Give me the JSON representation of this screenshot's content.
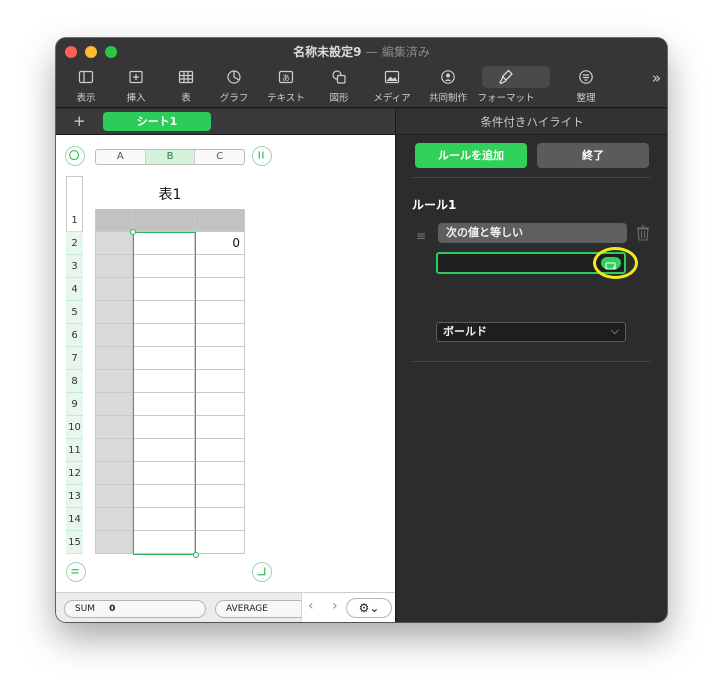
{
  "window": {
    "title": "名称未設定9",
    "separator": "—",
    "status": "編集済み"
  },
  "toolbar": {
    "items": [
      {
        "label": "表示",
        "icon": "view-icon"
      },
      {
        "label": "挿入",
        "icon": "insert-icon"
      },
      {
        "label": "表",
        "icon": "table-icon"
      },
      {
        "label": "グラフ",
        "icon": "chart-icon"
      },
      {
        "label": "テキスト",
        "icon": "text-icon"
      },
      {
        "label": "図形",
        "icon": "shape-icon"
      },
      {
        "label": "メディア",
        "icon": "media-icon"
      },
      {
        "label": "共同制作",
        "icon": "collaborate-icon"
      },
      {
        "label": "フォーマット",
        "icon": "format-icon"
      },
      {
        "label": "整理",
        "icon": "organize-icon"
      }
    ],
    "more": "»"
  },
  "sheet": {
    "add": "+",
    "tab": "シート1"
  },
  "table": {
    "columns": [
      "A",
      "B",
      "C"
    ],
    "title": "表1",
    "rows": [
      "1",
      "2",
      "3",
      "4",
      "5",
      "6",
      "7",
      "8",
      "9",
      "10",
      "11",
      "12",
      "13",
      "14",
      "15"
    ],
    "cell_c2": "0"
  },
  "statusbar": {
    "sum_label": "SUM",
    "sum_value": "0",
    "average_label": "AVERAGE",
    "gear": "⚙⌄"
  },
  "panel": {
    "header": "条件付きハイライト",
    "add_rule": "ルールを追加",
    "done": "終了",
    "rule_title": "ルール1",
    "condition": "次の値と等しい",
    "style": "ボールド"
  },
  "colors": {
    "accent": "#2fd158",
    "highlight": "#f3ec13"
  }
}
